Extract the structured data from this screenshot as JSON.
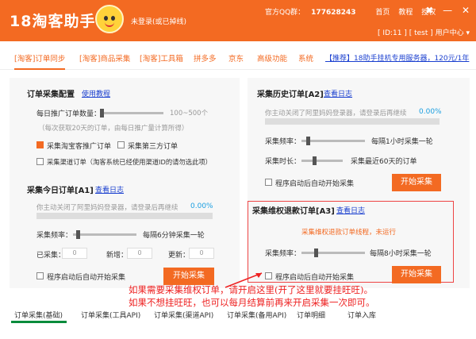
{
  "app": {
    "title": "18淘客助手",
    "login_status": "未登录(或已掉线)",
    "qq_group_label": "官方QQ群：",
    "qq_group_number": "177628243",
    "links": [
      "首页",
      "教程",
      "授权"
    ],
    "user_menu": "[ ID:11 ] [ test ] 用户中心 ▾"
  },
  "tabs": {
    "items": [
      "[淘客]订单同步",
      "[淘客]商品采集",
      "[淘客]工具箱",
      "拼多多",
      "京东",
      "高级功能",
      "系统"
    ],
    "promo": "【推荐】18助手挂机专用服务器，120元/1年"
  },
  "order_config": {
    "title": "订单采集配置",
    "link": "使用教程",
    "daily_label": "每日推广订单数量：",
    "daily_range": "100~500个",
    "daily_note": "（每次获取20天的订单，由每日推广量计算所得）",
    "opt_taobao": "采集淘宝客推广订单",
    "opt_third": "采集第三方订单",
    "opt_channel": "采集渠道订单（淘客系统已经使用渠道ID的请勿选此项）"
  },
  "today": {
    "title": "采集今日订单[A1]",
    "link": "查看日志",
    "msg": "你主动关闭了阿里妈妈登录器，请登录后再继续",
    "pct": "0.00%",
    "progress": 0,
    "freq_label": "采集频率：",
    "freq_value": "每隔6分钟采集一轮",
    "collected_label": "已采集：",
    "collected_value": "0",
    "new_label": "新增：",
    "new_value": "0",
    "update_label": "更新：",
    "update_value": "0",
    "autostart": "程序启动后自动开始采集",
    "start_btn": "开始采集"
  },
  "history": {
    "title": "采集历史订单[A2]",
    "link": "查看日志",
    "msg": "你主动关闭了阿里妈妈登录器，请登录后再继续",
    "pct": "0.00%",
    "progress": 0,
    "freq_label": "采集频率：",
    "freq_value": "每隔1小时采集一轮",
    "time_label": "采集时长：",
    "time_value": "采集最近60天的订单",
    "autostart": "程序启动后自动开始采集",
    "start_btn": "开始采集"
  },
  "refund": {
    "title": "采集维权退款订单[A3]",
    "link": "查看日志",
    "status": "采集维权退款订单线程，未运行",
    "freq_label": "采集频率：",
    "freq_value": "每隔8小时采集一轮",
    "autostart": "程序启动后自动开始采集",
    "start_btn": "开始采集"
  },
  "annotation": {
    "line1": "如果需要采集维权订单，请开启这里(开了这里就要挂旺旺)。",
    "line2": "如果不想挂旺旺，也可以每月结算前再来开启采集一次即可。"
  },
  "bottom_tabs": [
    "订单采集(基础)",
    "订单采集(工具API)",
    "订单采集(渠道API)",
    "订单采集(备用API)",
    "订单明细",
    "订单入库"
  ],
  "colors": {
    "brand": "#f36a22",
    "link": "#1a3fcf",
    "progress": "#1a9ee0",
    "annotation": "#e22222",
    "active_tab": "#0a8b3c"
  }
}
